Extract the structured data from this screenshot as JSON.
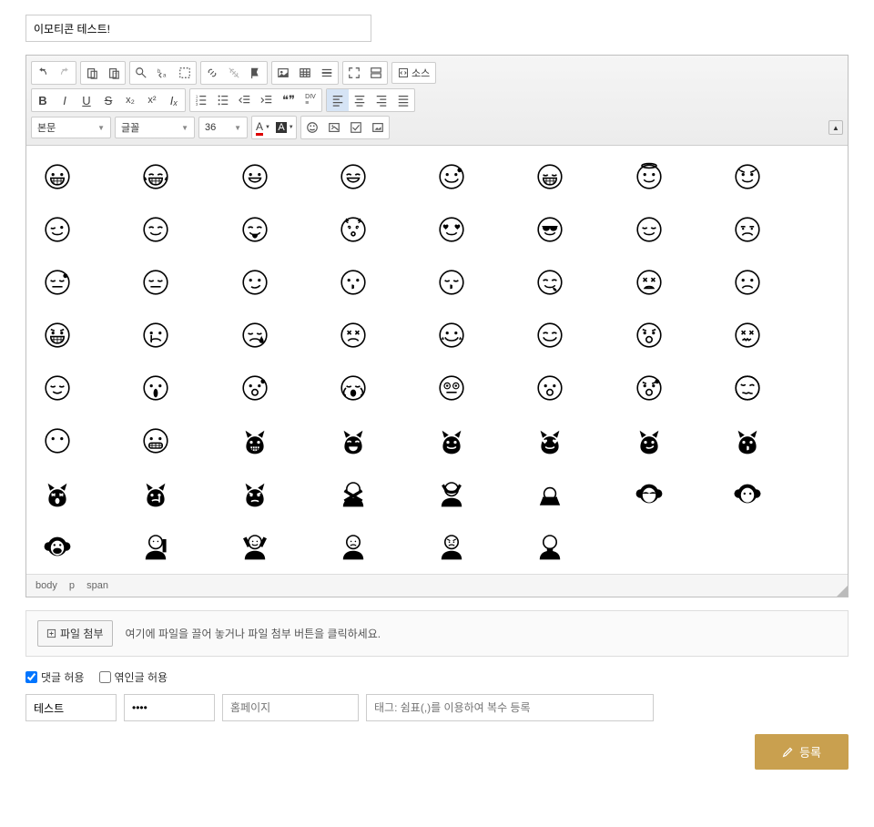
{
  "title_value": "이모티콘 테스트!",
  "toolbar": {
    "source_label": "소스",
    "format_select": "본문",
    "font_select": "글꼴",
    "size_select": "36",
    "icons": {
      "undo": "undo",
      "redo": "redo",
      "paste": "paste",
      "paste_text": "paste-text",
      "find": "find",
      "replace": "replace",
      "selectall": "selectall",
      "link": "link",
      "unlink": "unlink",
      "flag": "flag",
      "image": "image",
      "table": "table",
      "hr": "hr",
      "maximize": "maximize",
      "showblocks": "showblocks",
      "bold": "B",
      "italic": "I",
      "underline_char": "U",
      "strike_char": "S",
      "sub": "x₂",
      "sup": "x²",
      "removeformat": "Iₓ",
      "ol": "ol",
      "ul": "ul",
      "outdent": "outdent",
      "indent": "indent",
      "blockquote": "❝❞",
      "div": "DIV",
      "align_left": "left",
      "align_center": "center",
      "align_right": "right",
      "align_justify": "justify",
      "textcolor": "A",
      "bgcolor": "A",
      "smiley": "smiley",
      "imageplus": "imageplus",
      "check": "check",
      "imgblock": "imgblock"
    }
  },
  "emojis": [
    "grinning",
    "joy",
    "smile-open",
    "smile-closed",
    "smile-sweat",
    "laugh",
    "halo",
    "devil",
    "wink",
    "savoring",
    "tongue",
    "dizzy",
    "heart-eyes",
    "sunglasses",
    "relieved",
    "unamused",
    "downcast",
    "pensive",
    "smirk",
    "kissing",
    "kissing-closed",
    "yum",
    "tired",
    "frowning",
    "angry",
    "crying",
    "disappointed",
    "persevering",
    "smile-tears",
    "beaming",
    "anguished",
    "confounded",
    "smug",
    "yawning",
    "cold-sweat",
    "crying-loud",
    "flushed",
    "astonished",
    "fearful",
    "woozy",
    "no-mouth",
    "grimacing",
    "cat-grin",
    "cat-joy",
    "cat-smile",
    "cat-heart",
    "cat-smirk",
    "cat-kiss",
    "cat-weary",
    "cat-cry",
    "cat-pouting",
    "no-good",
    "ok-gesture",
    "bowing",
    "see-no-evil",
    "hear-no-evil",
    "speak-no-evil",
    "raising-hand",
    "happy-raise",
    "frowning-person",
    "pouting-person",
    "folded-hands",
    "",
    ""
  ],
  "path": {
    "body": "body",
    "p": "p",
    "span": "span"
  },
  "upload": {
    "button_label": "파일 첨부",
    "hint": "여기에 파일을 끌어 놓거나 파일 첨부 버튼을 클릭하세요."
  },
  "checks": {
    "allow_comment": "댓글 허용",
    "allow_trackback": "엮인글 허용",
    "comment_checked": true,
    "trackback_checked": false
  },
  "fields": {
    "nickname": "테스트",
    "password": "••••",
    "homepage_placeholder": "홈페이지",
    "tags_placeholder": "태그: 쉼표(,)를 이용하여 복수 등록"
  },
  "submit_label": "등록"
}
